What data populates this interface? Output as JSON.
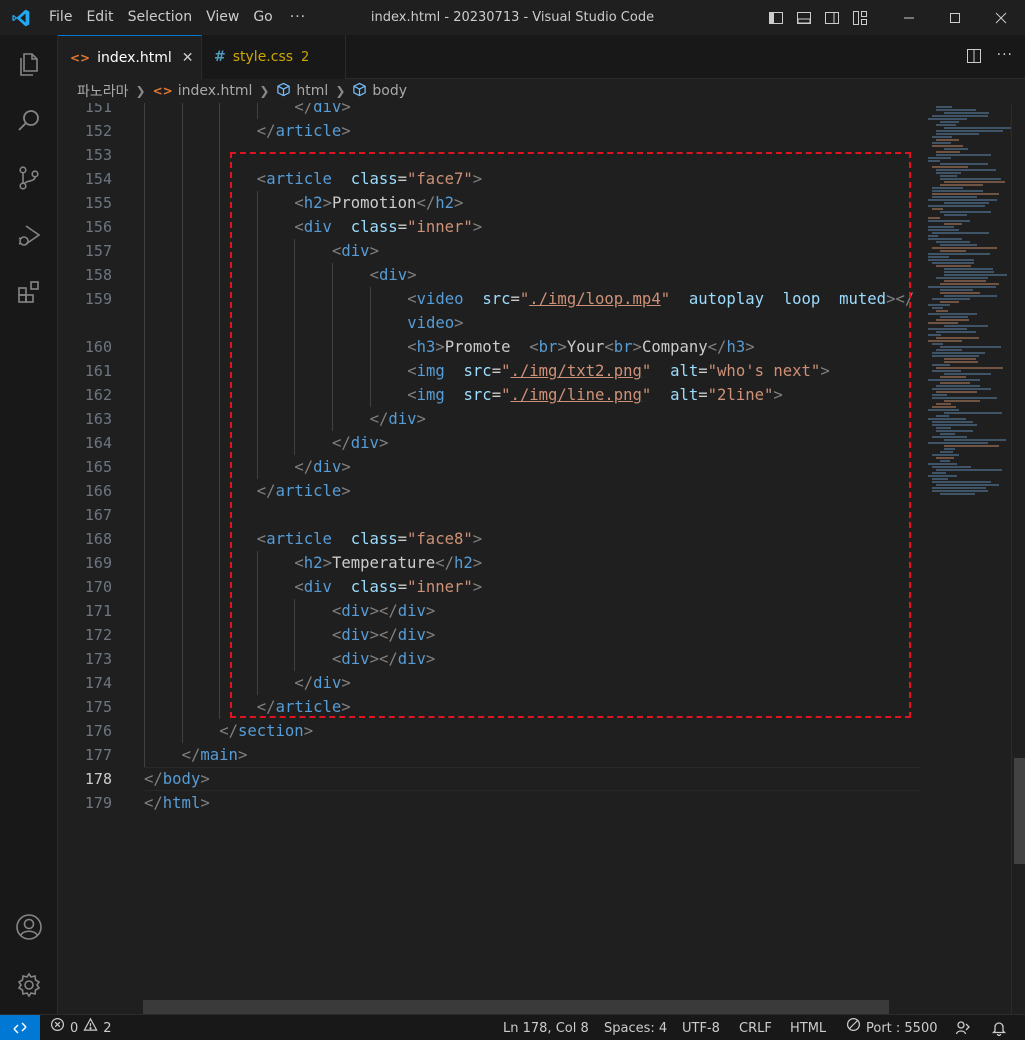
{
  "titlebar": {
    "menus": [
      "File",
      "Edit",
      "Selection",
      "View",
      "Go"
    ],
    "more": "···",
    "title": "index.html - 20230713 - Visual Studio Code"
  },
  "tabs": [
    {
      "label": "index.html",
      "icon": "html-file-icon",
      "icon_text": "<>",
      "active": true,
      "close": "✕"
    },
    {
      "label": "style.css",
      "icon": "css-file-icon",
      "icon_text": "#",
      "active": false,
      "badge": "2"
    }
  ],
  "breadcrumb": {
    "items": [
      "파노라마",
      "index.html",
      "html",
      "body"
    ]
  },
  "editor": {
    "current_line": 178,
    "lines": [
      {
        "n": "151",
        "indent": 4,
        "segs": [
          [
            "tg",
            "</"
          ],
          [
            "tn",
            "div"
          ],
          [
            "tg",
            ">"
          ]
        ]
      },
      {
        "n": "152",
        "indent": 3,
        "segs": [
          [
            "tg",
            "</"
          ],
          [
            "tn",
            "article"
          ],
          [
            "tg",
            ">"
          ]
        ]
      },
      {
        "n": "153",
        "indent": 3,
        "segs": []
      },
      {
        "n": "154",
        "indent": 3,
        "segs": [
          [
            "tg",
            "<"
          ],
          [
            "tn",
            "article"
          ],
          [
            "",
            "  "
          ],
          [
            "an",
            "class"
          ],
          [
            "",
            "="
          ],
          [
            "av",
            "\"face7\""
          ],
          [
            "tg",
            ">"
          ]
        ]
      },
      {
        "n": "155",
        "indent": 4,
        "segs": [
          [
            "tg",
            "<"
          ],
          [
            "tn",
            "h2"
          ],
          [
            "tg",
            ">"
          ],
          [
            "",
            "Promotion"
          ],
          [
            "tg",
            "</"
          ],
          [
            "tn",
            "h2"
          ],
          [
            "tg",
            ">"
          ]
        ]
      },
      {
        "n": "156",
        "indent": 4,
        "segs": [
          [
            "tg",
            "<"
          ],
          [
            "tn",
            "div"
          ],
          [
            "",
            "  "
          ],
          [
            "an",
            "class"
          ],
          [
            "",
            "="
          ],
          [
            "av",
            "\"inner\""
          ],
          [
            "tg",
            ">"
          ]
        ]
      },
      {
        "n": "157",
        "indent": 5,
        "segs": [
          [
            "tg",
            "<"
          ],
          [
            "tn",
            "div"
          ],
          [
            "tg",
            ">"
          ]
        ]
      },
      {
        "n": "158",
        "indent": 6,
        "segs": [
          [
            "tg",
            "<"
          ],
          [
            "tn",
            "div"
          ],
          [
            "tg",
            ">"
          ]
        ]
      },
      {
        "n": "159",
        "indent": 7,
        "segs": [
          [
            "tg",
            "<"
          ],
          [
            "tn",
            "video"
          ],
          [
            "",
            "  "
          ],
          [
            "an",
            "src"
          ],
          [
            "",
            "="
          ],
          [
            "av",
            "\""
          ],
          [
            "avu",
            "./img/loop.mp4"
          ],
          [
            "av",
            "\""
          ],
          [
            "",
            "  "
          ],
          [
            "an",
            "autoplay"
          ],
          [
            "",
            "  "
          ],
          [
            "an",
            "loop"
          ],
          [
            "",
            "  "
          ],
          [
            "an",
            "muted"
          ],
          [
            "tg",
            "></"
          ]
        ]
      },
      {
        "n": "",
        "indent": 7,
        "segs": [
          [
            "tn",
            "video"
          ],
          [
            "tg",
            ">"
          ]
        ]
      },
      {
        "n": "160",
        "indent": 7,
        "segs": [
          [
            "tg",
            "<"
          ],
          [
            "tn",
            "h3"
          ],
          [
            "tg",
            ">"
          ],
          [
            "",
            "Promote  "
          ],
          [
            "tg",
            "<"
          ],
          [
            "tn",
            "br"
          ],
          [
            "tg",
            ">"
          ],
          [
            "",
            "Your"
          ],
          [
            "tg",
            "<"
          ],
          [
            "tn",
            "br"
          ],
          [
            "tg",
            ">"
          ],
          [
            "",
            "Company"
          ],
          [
            "tg",
            "</"
          ],
          [
            "tn",
            "h3"
          ],
          [
            "tg",
            ">"
          ]
        ]
      },
      {
        "n": "161",
        "indent": 7,
        "segs": [
          [
            "tg",
            "<"
          ],
          [
            "tn",
            "img"
          ],
          [
            "",
            "  "
          ],
          [
            "an",
            "src"
          ],
          [
            "",
            "="
          ],
          [
            "av",
            "\""
          ],
          [
            "avu",
            "./img/txt2.png"
          ],
          [
            "av",
            "\""
          ],
          [
            "",
            "  "
          ],
          [
            "an",
            "alt"
          ],
          [
            "",
            "="
          ],
          [
            "av",
            "\"who's next\""
          ],
          [
            "tg",
            ">"
          ]
        ]
      },
      {
        "n": "162",
        "indent": 7,
        "segs": [
          [
            "tg",
            "<"
          ],
          [
            "tn",
            "img"
          ],
          [
            "",
            "  "
          ],
          [
            "an",
            "src"
          ],
          [
            "",
            "="
          ],
          [
            "av",
            "\""
          ],
          [
            "avu",
            "./img/line.png"
          ],
          [
            "av",
            "\""
          ],
          [
            "",
            "  "
          ],
          [
            "an",
            "alt"
          ],
          [
            "",
            "="
          ],
          [
            "av",
            "\"2line\""
          ],
          [
            "tg",
            ">"
          ]
        ]
      },
      {
        "n": "163",
        "indent": 6,
        "segs": [
          [
            "tg",
            "</"
          ],
          [
            "tn",
            "div"
          ],
          [
            "tg",
            ">"
          ]
        ]
      },
      {
        "n": "164",
        "indent": 5,
        "segs": [
          [
            "tg",
            "</"
          ],
          [
            "tn",
            "div"
          ],
          [
            "tg",
            ">"
          ]
        ]
      },
      {
        "n": "165",
        "indent": 4,
        "segs": [
          [
            "tg",
            "</"
          ],
          [
            "tn",
            "div"
          ],
          [
            "tg",
            ">"
          ]
        ]
      },
      {
        "n": "166",
        "indent": 3,
        "segs": [
          [
            "tg",
            "</"
          ],
          [
            "tn",
            "article"
          ],
          [
            "tg",
            ">"
          ]
        ]
      },
      {
        "n": "167",
        "indent": 3,
        "segs": []
      },
      {
        "n": "168",
        "indent": 3,
        "segs": [
          [
            "tg",
            "<"
          ],
          [
            "tn",
            "article"
          ],
          [
            "",
            "  "
          ],
          [
            "an",
            "class"
          ],
          [
            "",
            "="
          ],
          [
            "av",
            "\"face8\""
          ],
          [
            "tg",
            ">"
          ]
        ]
      },
      {
        "n": "169",
        "indent": 4,
        "segs": [
          [
            "tg",
            "<"
          ],
          [
            "tn",
            "h2"
          ],
          [
            "tg",
            ">"
          ],
          [
            "",
            "Temperature"
          ],
          [
            "tg",
            "</"
          ],
          [
            "tn",
            "h2"
          ],
          [
            "tg",
            ">"
          ]
        ]
      },
      {
        "n": "170",
        "indent": 4,
        "segs": [
          [
            "tg",
            "<"
          ],
          [
            "tn",
            "div"
          ],
          [
            "",
            "  "
          ],
          [
            "an",
            "class"
          ],
          [
            "",
            "="
          ],
          [
            "av",
            "\"inner\""
          ],
          [
            "tg",
            ">"
          ]
        ]
      },
      {
        "n": "171",
        "indent": 5,
        "segs": [
          [
            "tg",
            "<"
          ],
          [
            "tn",
            "div"
          ],
          [
            "tg",
            "></"
          ],
          [
            "tn",
            "div"
          ],
          [
            "tg",
            ">"
          ]
        ]
      },
      {
        "n": "172",
        "indent": 5,
        "segs": [
          [
            "tg",
            "<"
          ],
          [
            "tn",
            "div"
          ],
          [
            "tg",
            "></"
          ],
          [
            "tn",
            "div"
          ],
          [
            "tg",
            ">"
          ]
        ]
      },
      {
        "n": "173",
        "indent": 5,
        "segs": [
          [
            "tg",
            "<"
          ],
          [
            "tn",
            "div"
          ],
          [
            "tg",
            "></"
          ],
          [
            "tn",
            "div"
          ],
          [
            "tg",
            ">"
          ]
        ]
      },
      {
        "n": "174",
        "indent": 4,
        "segs": [
          [
            "tg",
            "</"
          ],
          [
            "tn",
            "div"
          ],
          [
            "tg",
            ">"
          ]
        ]
      },
      {
        "n": "175",
        "indent": 3,
        "segs": [
          [
            "tg",
            "</"
          ],
          [
            "tn",
            "article"
          ],
          [
            "tg",
            ">"
          ]
        ]
      },
      {
        "n": "176",
        "indent": 2,
        "segs": [
          [
            "tg",
            "</"
          ],
          [
            "tn",
            "section"
          ],
          [
            "tg",
            ">"
          ]
        ]
      },
      {
        "n": "177",
        "indent": 1,
        "segs": [
          [
            "tg",
            "</"
          ],
          [
            "tn",
            "main"
          ],
          [
            "tg",
            ">"
          ]
        ]
      },
      {
        "n": "178",
        "indent": 0,
        "segs": [
          [
            "tg",
            "</"
          ],
          [
            "tn",
            "body"
          ],
          [
            "tg",
            ">"
          ]
        ]
      },
      {
        "n": "179",
        "indent": 0,
        "segs": [
          [
            "tg",
            "</"
          ],
          [
            "tn",
            "html"
          ],
          [
            "tg",
            ">"
          ]
        ]
      }
    ]
  },
  "statusbar": {
    "errors": "0",
    "warnings": "2",
    "position": "Ln 178, Col 8",
    "spaces": "Spaces: 4",
    "encoding": "UTF-8",
    "eol": "CRLF",
    "language": "HTML",
    "port": "Port : 5500"
  },
  "colors": {
    "accent": "#0078d4",
    "highlight_box": "#e0141e",
    "html_icon": "#e37933",
    "css_icon": "#519aba",
    "css_tab_text": "#cca700"
  }
}
